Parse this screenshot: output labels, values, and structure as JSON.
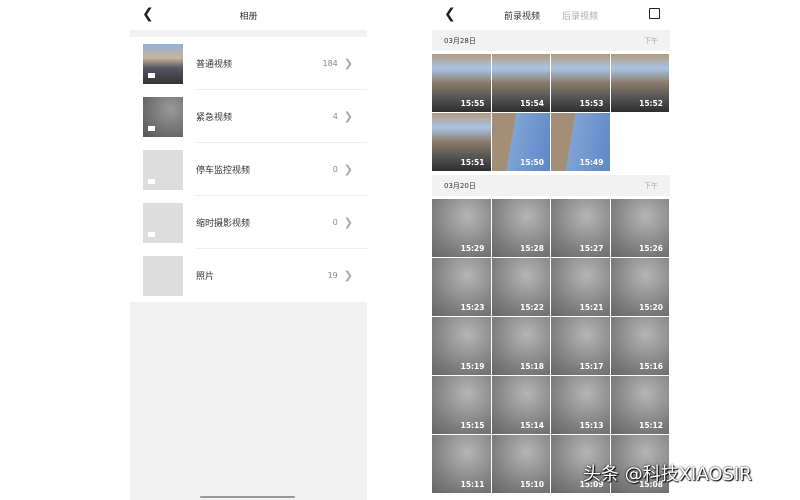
{
  "left": {
    "title": "相册",
    "items": [
      {
        "label": "普通视频",
        "count": "184",
        "thumb": "street"
      },
      {
        "label": "紧急视频",
        "count": "4",
        "thumb": "dark"
      },
      {
        "label": "停车监控视频",
        "count": "0",
        "thumb": "empty"
      },
      {
        "label": "缩时摄影视频",
        "count": "0",
        "thumb": "empty"
      },
      {
        "label": "照片",
        "count": "19",
        "thumb": "plain"
      }
    ]
  },
  "right": {
    "tabs": [
      "前录视频",
      "后录视频"
    ],
    "groups": [
      {
        "date": "03月28日",
        "period": "下午",
        "clips": [
          {
            "t": "15:55",
            "k": "street"
          },
          {
            "t": "15:54",
            "k": "street"
          },
          {
            "t": "15:53",
            "k": "street"
          },
          {
            "t": "15:52",
            "k": "street"
          },
          {
            "t": "15:51",
            "k": "street"
          },
          {
            "t": "15:50",
            "k": "sky"
          },
          {
            "t": "15:49",
            "k": "sky"
          }
        ]
      },
      {
        "date": "03月20日",
        "period": "下午",
        "clips": [
          {
            "t": "15:29",
            "k": "gray"
          },
          {
            "t": "15:28",
            "k": "gray"
          },
          {
            "t": "15:27",
            "k": "gray"
          },
          {
            "t": "15:26",
            "k": "gray"
          },
          {
            "t": "15:23",
            "k": "gray"
          },
          {
            "t": "15:22",
            "k": "gray"
          },
          {
            "t": "15:21",
            "k": "gray"
          },
          {
            "t": "15:20",
            "k": "gray"
          },
          {
            "t": "15:19",
            "k": "gray"
          },
          {
            "t": "15:18",
            "k": "gray"
          },
          {
            "t": "15:17",
            "k": "gray"
          },
          {
            "t": "15:16",
            "k": "gray"
          },
          {
            "t": "15:15",
            "k": "gray"
          },
          {
            "t": "15:14",
            "k": "gray"
          },
          {
            "t": "15:13",
            "k": "gray"
          },
          {
            "t": "15:12",
            "k": "gray"
          },
          {
            "t": "15:11",
            "k": "gray"
          },
          {
            "t": "15:10",
            "k": "gray"
          },
          {
            "t": "15:09",
            "k": "gray"
          },
          {
            "t": "15:08",
            "k": "gray"
          }
        ]
      }
    ]
  },
  "watermark": "头条 @科技XIAOSIR"
}
